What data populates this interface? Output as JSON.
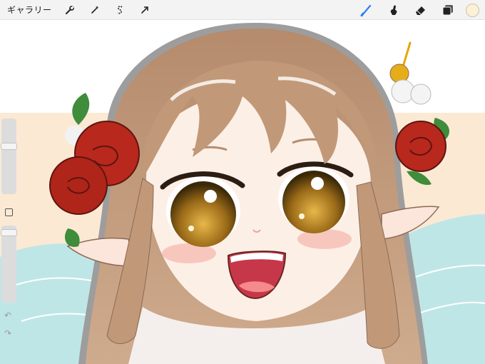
{
  "toolbar": {
    "gallery_label": "ギャラリー",
    "left_tools": [
      {
        "name": "actions",
        "icon": "wrench-icon"
      },
      {
        "name": "adjustments",
        "icon": "magic-wand-icon"
      },
      {
        "name": "selection",
        "icon": "selection-s-icon"
      },
      {
        "name": "transform",
        "icon": "arrow-cursor-icon"
      }
    ],
    "right_tools": [
      {
        "name": "brush",
        "icon": "brush-icon",
        "active": true
      },
      {
        "name": "smudge",
        "icon": "smudge-icon"
      },
      {
        "name": "eraser",
        "icon": "eraser-icon"
      },
      {
        "name": "layers",
        "icon": "layers-icon"
      }
    ],
    "active_tool_color": "#2f7df6",
    "current_color": "#fbf1d4"
  },
  "sidebar": {
    "brush_size_level": 0.35,
    "opacity_level": 0.05,
    "modify_button": "square-icon",
    "undo_icon": "undo-icon",
    "redo_icon": "redo-icon"
  },
  "canvas": {
    "subject": "elf-girl-illustration",
    "palette": {
      "hair": "#c8a283",
      "hair_shadow": "#a97e62",
      "skin": "#fcefe6",
      "blush": "#f5b7ad",
      "eyes": "#9a6a18",
      "roses": "#b8281d",
      "leaves": "#3f8c3a",
      "background_peach": "#fbe9d4",
      "background_mint": "#bfe6e6"
    }
  }
}
